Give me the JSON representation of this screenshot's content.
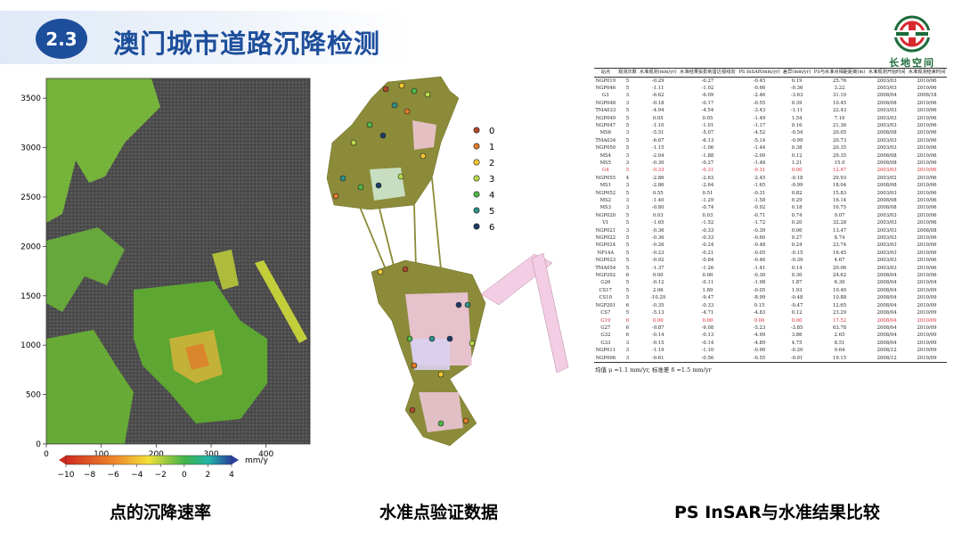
{
  "header": {
    "section_number": "2.3",
    "title": "澳门城市道路沉降检测",
    "logo_text": "长地空间"
  },
  "captions": {
    "left": "点的沉降速率",
    "middle": "水准点验证数据",
    "right": "PS InSAR与水准结果比较"
  },
  "colors": {
    "accent": "#1d4e9b",
    "header_gradient": "#dfe9f7",
    "highlight_row": "#d9282f",
    "map_land": "#8b8b3a",
    "map_sea_image": "#5a5a5a"
  },
  "chart_data": {
    "type": "scatter",
    "xlim": [
      0,
      480
    ],
    "ylim": [
      0,
      3700
    ],
    "x_ticks": [
      0,
      100,
      200,
      300,
      400
    ],
    "y_ticks": [
      0,
      500,
      1000,
      1500,
      2000,
      2500,
      3000,
      3500
    ],
    "colorbar": {
      "label": "mm/y",
      "range": [
        -10,
        4
      ],
      "ticks": [
        -10,
        -8,
        -6,
        -4,
        -2,
        0,
        2,
        4
      ]
    }
  },
  "map_legend": {
    "entries": [
      {
        "label": "0",
        "color": "#b04a2a"
      },
      {
        "label": "1",
        "color": "#e07b2b"
      },
      {
        "label": "2",
        "color": "#f2c531"
      },
      {
        "label": "3",
        "color": "#b7d84a"
      },
      {
        "label": "4",
        "color": "#4fb848"
      },
      {
        "label": "5",
        "color": "#2f8f86"
      },
      {
        "label": "6",
        "color": "#1e3b66"
      }
    ]
  },
  "table": {
    "headers": [
      "站点",
      "观测次数",
      "水准观测(mm/yr)",
      "水准结果投影到雷达视线向",
      "PS InSAR(mm/yr)",
      "差异(mm/yr)",
      "PS与水准点相距距离(m)",
      "水准观测开始时间",
      "水准观测结束时间"
    ],
    "rows": [
      [
        "NGP019",
        "5",
        "-0.29",
        "-0.27",
        "-0.45",
        "0.19",
        "25.76",
        "2003/03",
        "2010/06"
      ],
      [
        "NGP046",
        "5",
        "-1.11",
        "-1.02",
        "-0.66",
        "-0.36",
        "3.22",
        "2003/03",
        "2010/06"
      ],
      [
        "G3",
        "3",
        "-6.62",
        "-6.09",
        "-2.46",
        "-3.63",
        "31.10",
        "2008/04",
        "2008/18"
      ],
      [
        "NGP048",
        "3",
        "-0.18",
        "-0.17",
        "-0.55",
        "0.39",
        "10.45",
        "2008/08",
        "2010/06"
      ],
      [
        "TMA033",
        "5",
        "-4.94",
        "-4.54",
        "-3.43",
        "-1.11",
        "22.43",
        "2003/03",
        "2010/06"
      ],
      [
        "NGP049",
        "5",
        "0.05",
        "0.05",
        "-1.49",
        "1.54",
        "7.10",
        "2003/03",
        "2010/06"
      ],
      [
        "NGP047",
        "5",
        "-1.10",
        "-1.01",
        "-1.17",
        "0.16",
        "21.36",
        "2003/03",
        "2010/06"
      ],
      [
        "MS6",
        "3",
        "-5.51",
        "-5.07",
        "-4.52",
        "-0.54",
        "20.05",
        "2008/08",
        "2010/06"
      ],
      [
        "TMA034",
        "5",
        "-6.67",
        "-6.13",
        "-5.14",
        "-0.99",
        "20.73",
        "2003/03",
        "2010/06"
      ],
      [
        "NGP050",
        "5",
        "-1.15",
        "-1.06",
        "-1.44",
        "0.38",
        "20.35",
        "2003/03",
        "2010/06"
      ],
      [
        "MS4",
        "3",
        "-2.04",
        "-1.88",
        "-2.00",
        "0.12",
        "29.35",
        "2008/08",
        "2010/06"
      ],
      [
        "MS5",
        "3",
        "-0.30",
        "-0.27",
        "-1.48",
        "1.21",
        "15.0",
        "2008/08",
        "2010/06"
      ],
      [
        "G4",
        "5",
        "-0.33",
        "-0.31",
        "-0.31",
        "0.00",
        "12.47",
        "2003/03",
        "2010/06"
      ],
      [
        "NGP055",
        "4",
        "-2.86",
        "-2.63",
        "-2.45",
        "-0.18",
        "20.93",
        "2003/02",
        "2010/06"
      ],
      [
        "MS1",
        "3",
        "-2.86",
        "-2.64",
        "-1.65",
        "-0.99",
        "18.04",
        "2008/08",
        "2010/06"
      ],
      [
        "NGP052",
        "5",
        "0.55",
        "0.51",
        "-0.31",
        "0.82",
        "15.83",
        "2003/03",
        "2010/06"
      ],
      [
        "MS2",
        "3",
        "-1.40",
        "-1.29",
        "-1.58",
        "0.29",
        "16.14",
        "2008/08",
        "2010/06"
      ],
      [
        "MS3",
        "3",
        "-0.80",
        "-0.74",
        "-0.92",
        "0.18",
        "16.75",
        "2008/08",
        "2010/06"
      ],
      [
        "NGP020",
        "5",
        "0.03",
        "0.03",
        "-0.71",
        "0.74",
        "9.07",
        "2003/03",
        "2010/06"
      ],
      [
        "V1",
        "5",
        "-1.65",
        "-1.52",
        "-1.72",
        "0.20",
        "32.28",
        "2003/03",
        "2010/06"
      ],
      [
        "NGP021",
        "3",
        "-0.36",
        "-0.33",
        "-0.39",
        "0.06",
        "13.47",
        "2003/03",
        "2008/08"
      ],
      [
        "NGP022",
        "5",
        "-0.36",
        "-0.33",
        "-0.60",
        "0.27",
        "8.74",
        "2003/03",
        "2010/06"
      ],
      [
        "NGP024",
        "5",
        "-0.26",
        "-0.24",
        "-0.48",
        "0.24",
        "23.74",
        "2003/03",
        "2010/06"
      ],
      [
        "NP14A",
        "5",
        "-0.23",
        "-0.21",
        "-0.05",
        "-0.15",
        "16.45",
        "2003/03",
        "2010/06"
      ],
      [
        "NGP023",
        "5",
        "-0.92",
        "-0.84",
        "-0.46",
        "-0.39",
        "4.67",
        "2003/03",
        "2010/06"
      ],
      [
        "TMA054",
        "5",
        "-1.37",
        "-1.26",
        "-1.41",
        "0.14",
        "20.06",
        "2003/03",
        "2010/06"
      ],
      [
        "NGP202",
        "6",
        "0.00",
        "0.00",
        "-0.30",
        "0.30",
        "24.62",
        "2008/04",
        "2010/06"
      ],
      [
        "G26",
        "5",
        "-0.12",
        "-0.11",
        "-1.98",
        "1.87",
        "6.30",
        "2008/04",
        "2010/04"
      ],
      [
        "CS17",
        "5",
        "2.06",
        "1.89",
        "-0.05",
        "1.93",
        "10.40",
        "2008/04",
        "2010/09"
      ],
      [
        "CS10",
        "5",
        "-10.29",
        "-9.47",
        "-8.99",
        "-0.48",
        "10.88",
        "2008/04",
        "2010/09"
      ],
      [
        "NGP201",
        "6",
        "-0.35",
        "-0.33",
        "0.15",
        "-0.47",
        "12.65",
        "2008/04",
        "2010/09"
      ],
      [
        "CS7",
        "5",
        "-5.13",
        "-4.71",
        "-4.83",
        "0.12",
        "23.29",
        "2008/04",
        "2010/09"
      ],
      [
        "G19",
        "6",
        "0.00",
        "0.00",
        "0.00",
        "0.00",
        "17.52",
        "2008/04",
        "2010/09"
      ],
      [
        "G27",
        "6",
        "-9.87",
        "-9.08",
        "-5.23",
        "-3.85",
        "63.78",
        "2008/04",
        "2010/09"
      ],
      [
        "G32",
        "6",
        "-0.14",
        "-0.13",
        "-4.99",
        "3.86",
        "2.65",
        "2008/04",
        "2010/09"
      ],
      [
        "G33",
        "3",
        "-0.15",
        "-0.14",
        "-4.89",
        "4.75",
        "8.51",
        "2008/04",
        "2010/09"
      ],
      [
        "NGP011",
        "3",
        "-1.19",
        "-1.10",
        "-0.90",
        "-0.20",
        "9.64",
        "2008/12",
        "2010/09"
      ],
      [
        "NGP006",
        "3",
        "-0.61",
        "-0.56",
        "-0.55",
        "-0.01",
        "19.15",
        "2008/12",
        "2010/09"
      ]
    ],
    "highlight_rows": [
      12,
      32
    ],
    "note": "均值 μ =1.1 mm/yr, 标准差 δ =1.5 mm/yr"
  }
}
